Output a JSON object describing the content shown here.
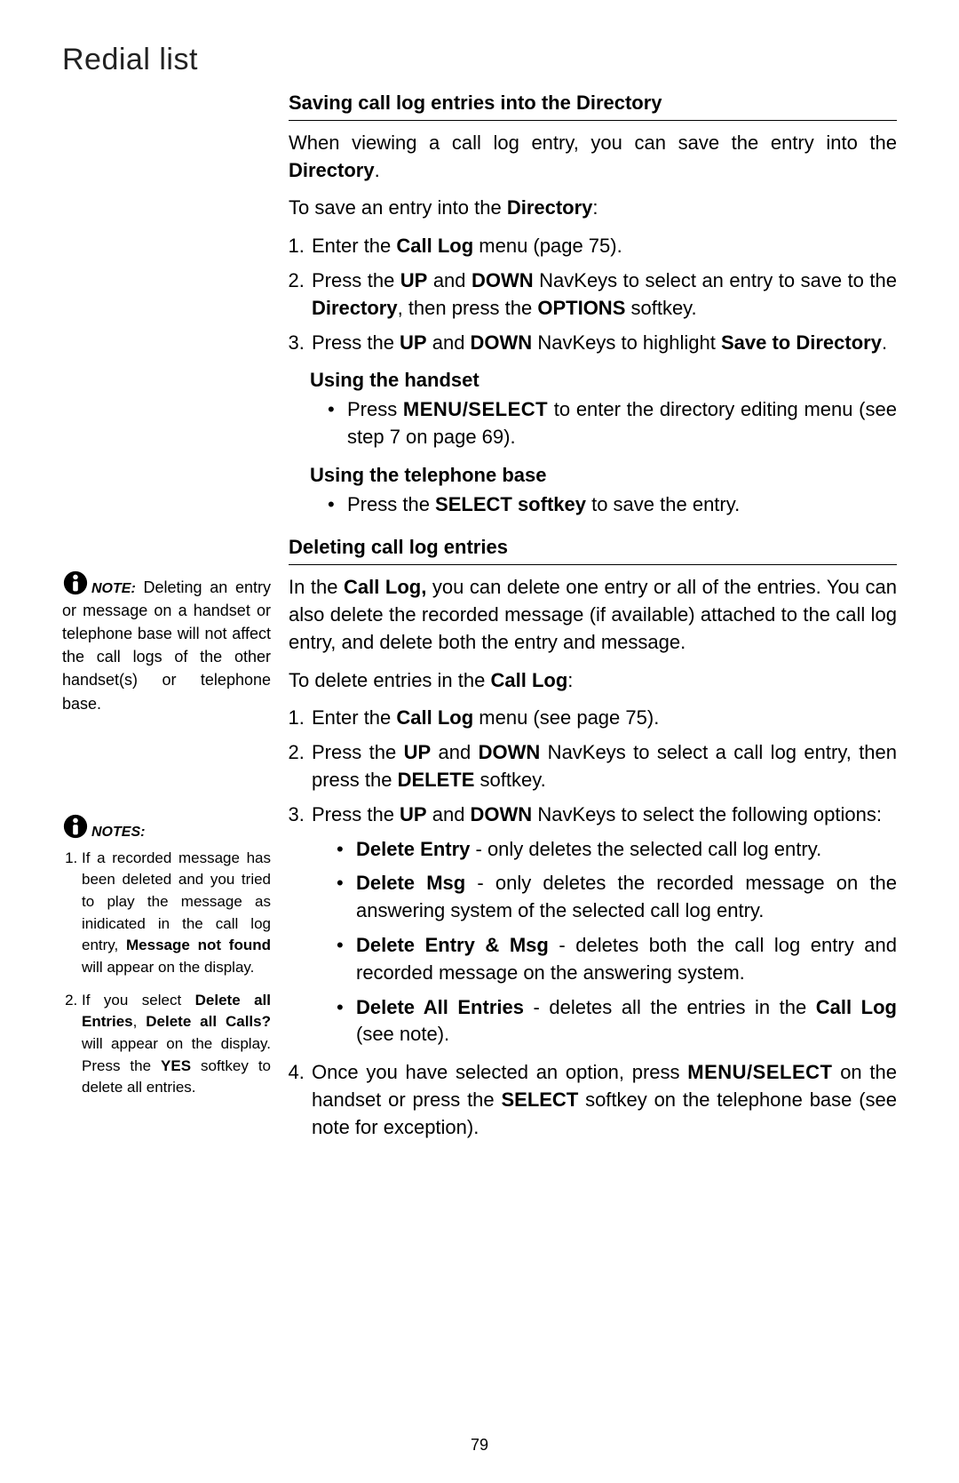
{
  "pageTitle": "Redial list",
  "pageNumber": "79",
  "side": {
    "note1": {
      "label": "NOTE:",
      "text_before": "Deleting an entry or message on a handset or telephone base will not affect the call logs of the other handset(s) or telephone base."
    },
    "notes2": {
      "label": "NOTES:",
      "items": [
        {
          "pre": "If a recorded message has been deleted and you tried to play the message as inidicated in the call log entry, ",
          "bold": "Message not found",
          "post": " will appear on the display."
        },
        {
          "pre": "If you select ",
          "b1": "Delete all Entries",
          "mid": ", ",
          "b2": "Delete all Calls?",
          "post": " will appear on the display. Press the ",
          "b3": "YES",
          "tail": " softkey to delete all entries."
        }
      ]
    }
  },
  "main": {
    "s1": {
      "heading": "Saving call log entries into the Directory",
      "intro_pre": "When viewing a call log entry, you can save the entry into the ",
      "intro_b": "Directory",
      "intro_post": ".",
      "lead_pre": "To save an entry into the ",
      "lead_b": "Directory",
      "lead_post": ":",
      "step1_pre": "Enter the ",
      "step1_b": "Call Log",
      "step1_post": " menu (page 75).",
      "step2_pre": "Press the ",
      "step2_b1": "UP",
      "step2_mid1": " and ",
      "step2_b2": "DOWN",
      "step2_mid2": " NavKeys to select an entry to save to the ",
      "step2_b3": "Directory",
      "step2_mid3": ", then press the ",
      "step2_b4": "OPTIONS",
      "step2_post": " softkey.",
      "step3_pre": "Press the ",
      "step3_b1": "UP",
      "step3_mid1": " and ",
      "step3_b2": "DOWN",
      "step3_mid2": " NavKeys to highlight ",
      "step3_b3": "Save to Directory",
      "step3_post": ".",
      "sub_handset": "Using the handset",
      "handset_pre": "Press ",
      "handset_sc": "MENU/SELECT",
      "handset_post": " to enter the directory editing menu (see step 7 on page 69).",
      "sub_base": "Using the telephone base",
      "base_pre": "Press the ",
      "base_b": "SELECT softkey",
      "base_post": " to save the entry."
    },
    "s2": {
      "heading": "Deleting call log entries",
      "intro_pre": "In the ",
      "intro_b": "Call Log,",
      "intro_post": " you can delete one entry or all of the entries. You can also delete the recorded message (if available) attached to the call log entry, and delete both the entry and message.",
      "lead_pre": "To delete entries in the ",
      "lead_b": "Call Log",
      "lead_post": ":",
      "step1_pre": "Enter the ",
      "step1_b": "Call Log",
      "step1_post": " menu (see page 75).",
      "step2_pre": "Press the ",
      "step2_b1": "UP",
      "step2_mid1": " and ",
      "step2_b2": "DOWN",
      "step2_mid2": " NavKeys to select a call log entry, then press the ",
      "step2_b3": "DELETE",
      "step2_post": " softkey.",
      "step3_pre": "Press the ",
      "step3_b1": "UP",
      "step3_mid1": " and ",
      "step3_b2": "DOWN",
      "step3_post": " NavKeys to select the following options:",
      "opt1_b": "Delete Entry",
      "opt1_post": " - only deletes the selected call log entry.",
      "opt2_b": "Delete Msg",
      "opt2_post": " - only deletes the recorded message on the answering system of the selected call log entry.",
      "opt3_b": "Delete Entry & Msg",
      "opt3_post": " - deletes both the call log entry and recorded message on the answering system.",
      "opt4_b": "Delete All Entries",
      "opt4_post_pre": " - deletes all the entries in the ",
      "opt4_post_b": "Call Log",
      "opt4_post_post": " (see note).",
      "step4_pre": "Once you have selected an option, press ",
      "step4_sc": "MENU/SELECT",
      "step4_mid": " on the handset or press the ",
      "step4_b": "SELECT",
      "step4_post": " softkey on the telephone base (see note for exception)."
    }
  }
}
